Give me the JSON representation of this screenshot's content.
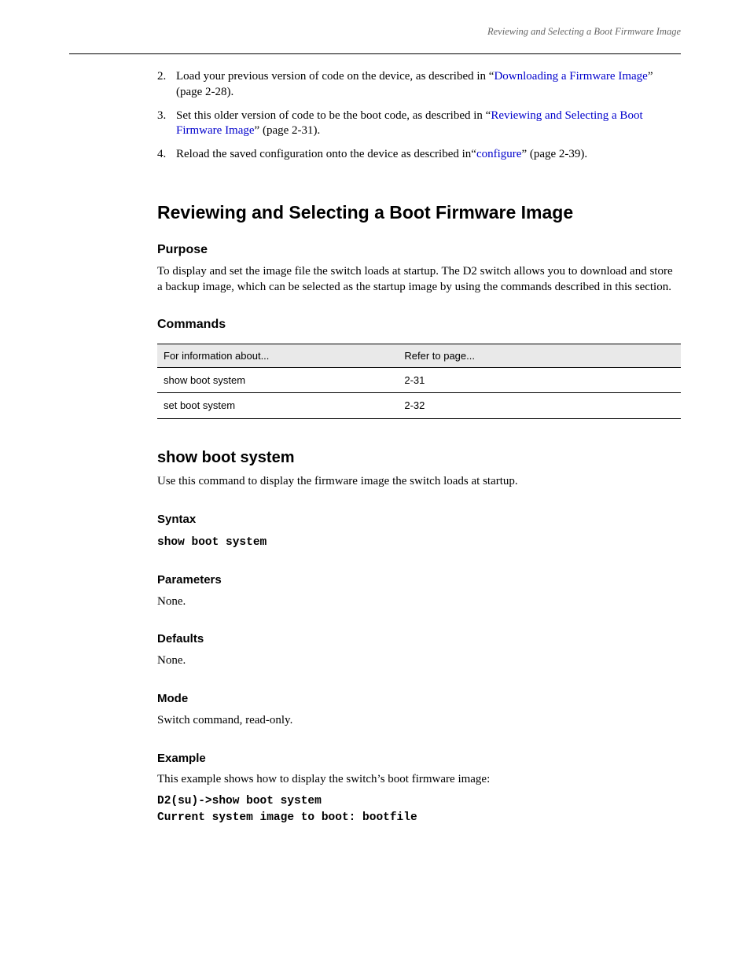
{
  "header": {
    "section_label": "Reviewing and Selecting a Boot Firmware Image"
  },
  "list": {
    "item2": {
      "num": "2.",
      "pre": "Load your previous version of code on the device, as described in “",
      "link": "Downloading a Firmware Image",
      "post": "” (page 2-28)."
    },
    "item3": {
      "num": "3.",
      "pre": "Set this older version of code to be the boot code, as described in “",
      "link": "Reviewing and Selecting a Boot Firmware Image",
      "post": "” (page 2-31)."
    },
    "item4": {
      "num": "4.",
      "pre": "Reload the saved configuration onto the device as described in“",
      "link": "configure",
      "post": "” (page 2-39)."
    }
  },
  "section": {
    "title": "Reviewing and Selecting a Boot Firmware Image",
    "purpose_label": "Purpose",
    "purpose_body": "To display and set the image file the switch loads at startup. The D2 switch allows you to download and store a backup image, which can be selected as the startup image by using the commands described in this section.",
    "commands_label": "Commands"
  },
  "table": {
    "header": {
      "col1": "For information about...",
      "col2": "Refer to page..."
    },
    "rows": [
      {
        "col1": "show boot system",
        "col2": "2-31"
      },
      {
        "col1": "set boot system",
        "col2": "2-32"
      }
    ]
  },
  "cmd": {
    "title": "show boot system",
    "desc": "Use this command to display the firmware image the switch loads at startup.",
    "syntax_label": "Syntax",
    "syntax_value": "show boot system",
    "parameters_label": "Parameters",
    "parameters_value": "None.",
    "defaults_label": "Defaults",
    "defaults_value": "None.",
    "mode_label": "Mode",
    "mode_value": "Switch command, read-only.",
    "example_label": "Example",
    "example_desc": "This example shows how to display the switch’s boot firmware image:",
    "example_code1": "D2(su)->show boot system",
    "example_code2": "Current system image to boot: bootfile"
  }
}
